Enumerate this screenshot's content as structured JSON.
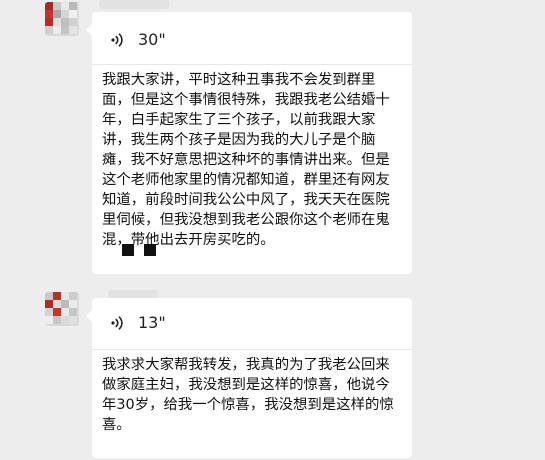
{
  "chat": {
    "messages": [
      {
        "voice_duration": "30\"",
        "transcript": "我跟大家讲，平时这种丑事我不会发到群里面，但是这个事情很特殊，我跟我老公结婚十年，白手起家生了三个孩子，以前我跟大家讲，我生两个孩子是因为我的大儿子是个脑瘫，我不好意思把这种坏的事情讲出来。但是这个老师他家里的情况都知道，群里还有网友知道，前段时间我公公中风了，我天天在医院里伺候，但我没想到我老公跟你这个老师在鬼混，带他出去开房买吃的。"
      },
      {
        "voice_duration": "13\"",
        "transcript": "我求求大家帮我转发，我真的为了我老公回来做家庭主妇，我没想到是这样的惊喜，他说今年30岁，给我一个惊喜，我没想到是这样的惊喜。"
      }
    ]
  },
  "icons": {
    "voice": "voice-message-icon",
    "avatar": "pixelated-avatar"
  },
  "colors": {
    "background": "#ededed",
    "bubble": "#ffffff",
    "text": "#111111",
    "avatar_accent": "#c2352c"
  }
}
